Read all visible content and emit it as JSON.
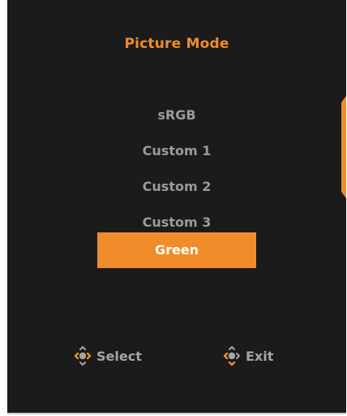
{
  "menu": {
    "title": "Picture Mode",
    "items": [
      {
        "label": "sRGB",
        "selected": false
      },
      {
        "label": "Custom 1",
        "selected": false
      },
      {
        "label": "Custom 2",
        "selected": false
      },
      {
        "label": "Custom 3",
        "selected": false
      },
      {
        "label": "Green",
        "selected": true
      }
    ]
  },
  "footer": {
    "select_label": "Select",
    "exit_label": "Exit",
    "select_icon": "joystick-left-right-icon",
    "exit_icon": "joystick-up-down-icon"
  },
  "colors": {
    "accent": "#f08c2a",
    "background": "#1b1b1b",
    "text_dim": "#9b9b9b"
  }
}
